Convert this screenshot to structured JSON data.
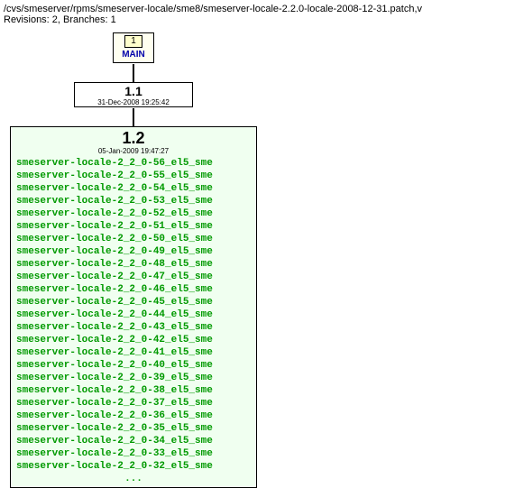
{
  "header": {
    "path": "/cvs/smeserver/rpms/smeserver-locale/sme8/smeserver-locale-2.2.0-locale-2008-12-31.patch,v",
    "meta": "Revisions: 2, Branches: 1"
  },
  "branch": {
    "label": "1",
    "name": "MAIN"
  },
  "rev11": {
    "version": "1.1",
    "date": "31-Dec-2008 19:25:42"
  },
  "rev12": {
    "version": "1.2",
    "date": "05-Jan-2009 19:47:27",
    "tags": [
      "smeserver-locale-2_2_0-56_el5_sme",
      "smeserver-locale-2_2_0-55_el5_sme",
      "smeserver-locale-2_2_0-54_el5_sme",
      "smeserver-locale-2_2_0-53_el5_sme",
      "smeserver-locale-2_2_0-52_el5_sme",
      "smeserver-locale-2_2_0-51_el5_sme",
      "smeserver-locale-2_2_0-50_el5_sme",
      "smeserver-locale-2_2_0-49_el5_sme",
      "smeserver-locale-2_2_0-48_el5_sme",
      "smeserver-locale-2_2_0-47_el5_sme",
      "smeserver-locale-2_2_0-46_el5_sme",
      "smeserver-locale-2_2_0-45_el5_sme",
      "smeserver-locale-2_2_0-44_el5_sme",
      "smeserver-locale-2_2_0-43_el5_sme",
      "smeserver-locale-2_2_0-42_el5_sme",
      "smeserver-locale-2_2_0-41_el5_sme",
      "smeserver-locale-2_2_0-40_el5_sme",
      "smeserver-locale-2_2_0-39_el5_sme",
      "smeserver-locale-2_2_0-38_el5_sme",
      "smeserver-locale-2_2_0-37_el5_sme",
      "smeserver-locale-2_2_0-36_el5_sme",
      "smeserver-locale-2_2_0-35_el5_sme",
      "smeserver-locale-2_2_0-34_el5_sme",
      "smeserver-locale-2_2_0-33_el5_sme",
      "smeserver-locale-2_2_0-32_el5_sme"
    ],
    "ellipsis": "..."
  }
}
